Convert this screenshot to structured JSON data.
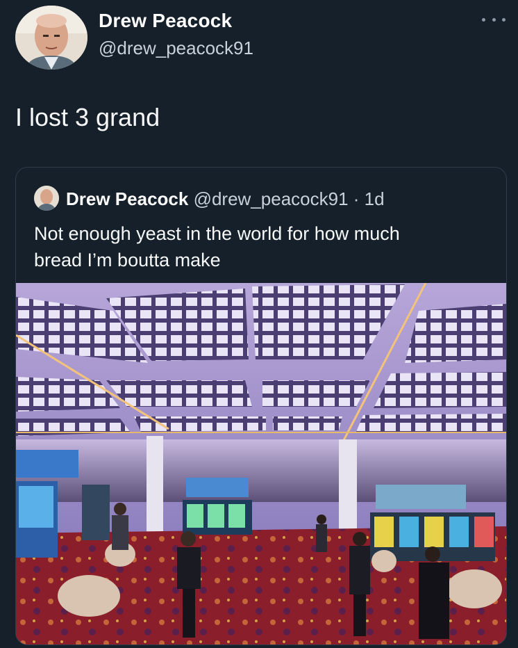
{
  "tweet": {
    "author_name": "Drew Peacock",
    "author_handle": "@drew_peacock91",
    "text": "I lost 3 grand",
    "more_icon": "more-horizontal-icon"
  },
  "quoted_tweet": {
    "author_name": "Drew Peacock",
    "author_handle": "@drew_peacock91",
    "separator": "·",
    "time": "1d",
    "text_lines": [
      "Not enough yeast in the world for how much",
      "bread I’m boutta make"
    ],
    "media_description_icon": "casino-photo"
  },
  "colors": {
    "background": "#15202b",
    "text_primary": "#ffffff",
    "text_secondary": "#c9d1d9",
    "border": "#2f3b47"
  }
}
